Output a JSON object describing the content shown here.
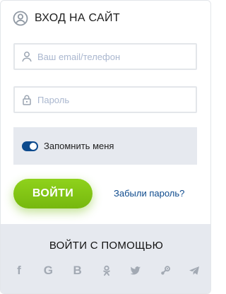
{
  "header": {
    "title": "ВХОД НА САЙТ",
    "icon": "user-circle-icon"
  },
  "form": {
    "email": {
      "value": "",
      "placeholder": "Ваш email/телефон",
      "icon": "user-icon"
    },
    "password": {
      "value": "",
      "placeholder": "Пароль",
      "icon": "lock-icon"
    },
    "remember": {
      "label": "Запомнить меня",
      "checked": true
    },
    "submit_label": "ВОЙТИ",
    "forgot_label": "Забыли пароль?"
  },
  "social": {
    "heading": "ВОЙТИ С ПОМОЩЬЮ",
    "providers": [
      {
        "name": "facebook",
        "glyph": "f"
      },
      {
        "name": "google",
        "glyph": "G"
      },
      {
        "name": "vkontakte",
        "glyph": "B"
      },
      {
        "name": "odnoklassniki",
        "glyph": ""
      },
      {
        "name": "twitter",
        "glyph": ""
      },
      {
        "name": "steam",
        "glyph": ""
      },
      {
        "name": "telegram",
        "glyph": ""
      }
    ]
  },
  "colors": {
    "accent": "#0d4a8d",
    "button": "#7dc114",
    "muted_icon": "#a2a9b3",
    "panel_gray": "#e6e9ef"
  }
}
